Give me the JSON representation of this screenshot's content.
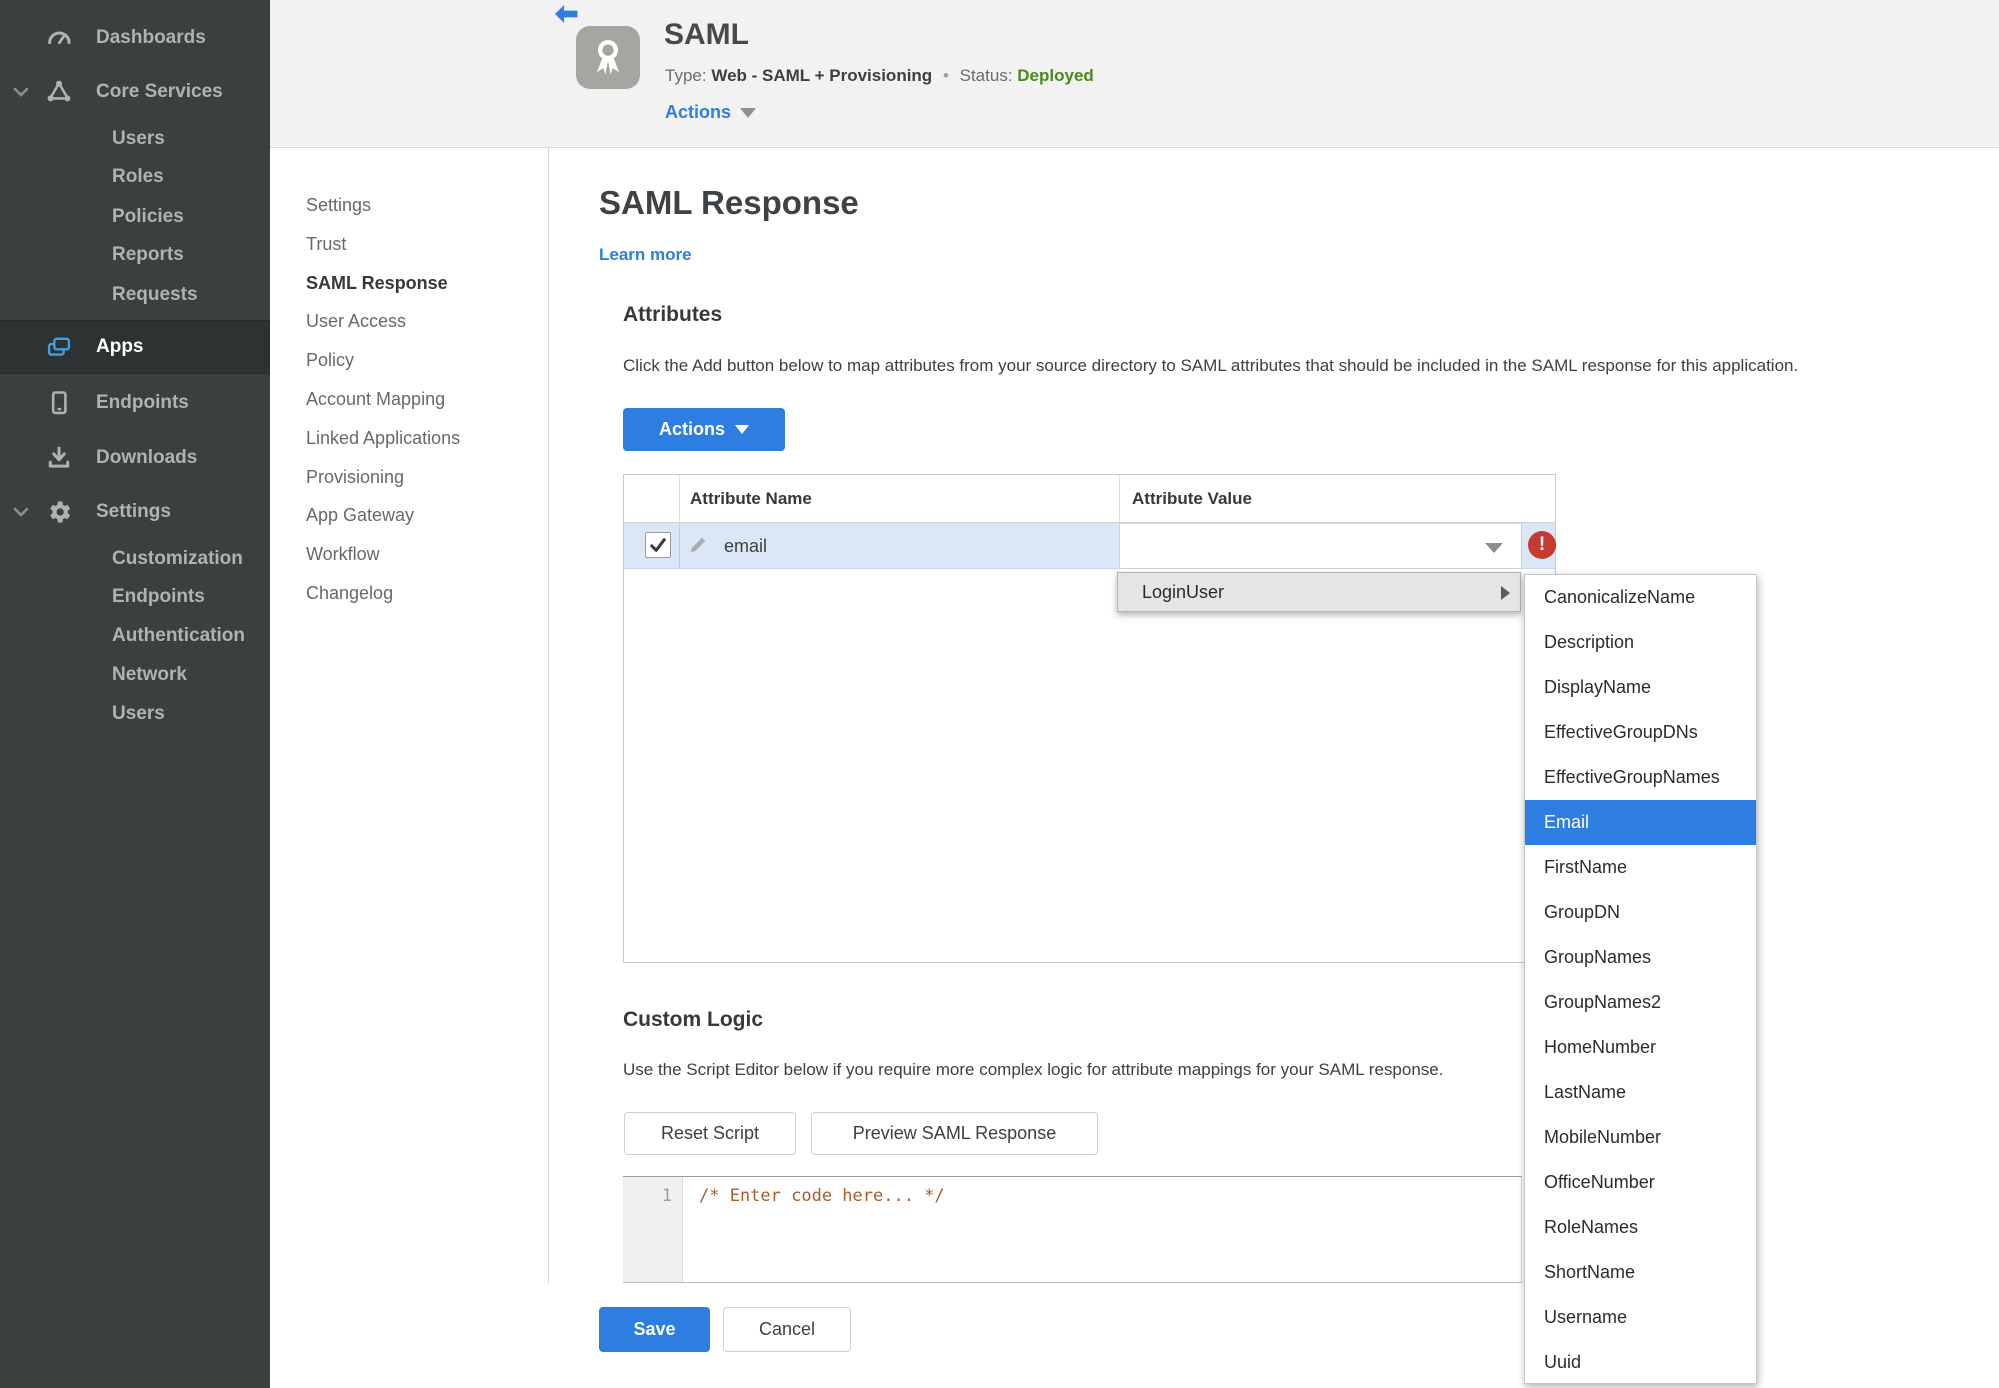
{
  "colors": {
    "accent_blue": "#2e7de1",
    "status_green": "#478b1f",
    "error_red": "#c63a2f",
    "row_highlight": "#dbe7f7",
    "sidebar_bg": "#3a403f",
    "code_comment": "#a95c2b"
  },
  "icons": {
    "back": "back-arrow",
    "app_badge": "award-ribbon",
    "dashboards": "gauge",
    "core_services": "network-triangle",
    "apps": "stacked-windows",
    "endpoints": "tablet",
    "downloads": "download-tray",
    "settings": "gear",
    "edit": "pencil",
    "error": "exclamation-circle",
    "dropdown": "caret-down",
    "submenu": "arrow-right",
    "checked": "checkmark"
  },
  "sidebar": {
    "dashboards": "Dashboards",
    "core_services": "Core Services",
    "core_children": [
      "Users",
      "Roles",
      "Policies",
      "Reports",
      "Requests"
    ],
    "apps": "Apps",
    "endpoints": "Endpoints",
    "downloads": "Downloads",
    "settings": "Settings",
    "settings_children": [
      "Customization",
      "Endpoints",
      "Authentication",
      "Network",
      "Users"
    ]
  },
  "header": {
    "app_name": "SAML",
    "type_label": "Type:",
    "type_value": "Web - SAML + Provisioning",
    "dot": "•",
    "status_label": "Status:",
    "status_value": "Deployed",
    "actions_label": "Actions"
  },
  "subnav": {
    "items": [
      "Settings",
      "Trust",
      "SAML Response",
      "User Access",
      "Policy",
      "Account Mapping",
      "Linked Applications",
      "Provisioning",
      "App Gateway",
      "Workflow",
      "Changelog"
    ],
    "active": "SAML Response"
  },
  "main": {
    "title": "SAML Response",
    "learn_more": "Learn more",
    "attributes": {
      "heading": "Attributes",
      "description": "Click the Add button below to map attributes from your source directory to SAML attributes that should be included in the SAML response for this application.",
      "actions_button": "Actions",
      "columns": [
        "Attribute Name",
        "Attribute Value"
      ],
      "row": {
        "name": "email",
        "value": "",
        "checked": true,
        "error": true
      }
    },
    "value_menu": {
      "parent": "LoginUser",
      "selected": "Email",
      "options": [
        "CanonicalizeName",
        "Description",
        "DisplayName",
        "EffectiveGroupDNs",
        "EffectiveGroupNames",
        "Email",
        "FirstName",
        "GroupDN",
        "GroupNames",
        "GroupNames2",
        "HomeNumber",
        "LastName",
        "MobileNumber",
        "OfficeNumber",
        "RoleNames",
        "ShortName",
        "Username",
        "Uuid"
      ]
    },
    "custom_logic": {
      "heading": "Custom Logic",
      "description": "Use the Script Editor below if you require more complex logic for attribute mappings for your SAML response.",
      "reset_button": "Reset Script",
      "preview_button": "Preview SAML Response",
      "editor": {
        "line_number": "1",
        "code": "/* Enter code here... */"
      }
    },
    "footer": {
      "save": "Save",
      "cancel": "Cancel"
    }
  }
}
